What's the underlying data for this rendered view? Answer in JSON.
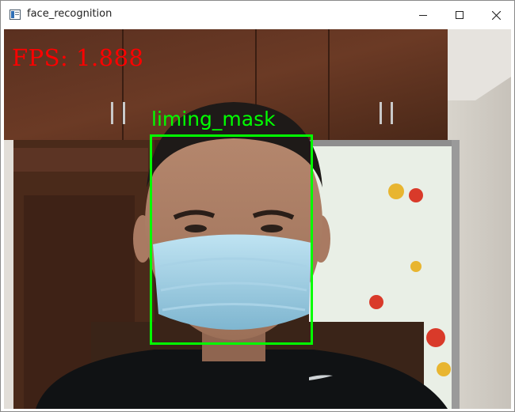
{
  "window": {
    "title": "face_recognition",
    "controls": [
      "minimize-icon",
      "maximize-icon",
      "close-icon"
    ]
  },
  "overlay": {
    "fps_text": "FPS: 1.888",
    "fps_color": "#ff0000",
    "face_label": "liming_mask",
    "box_color": "#00ff00"
  }
}
